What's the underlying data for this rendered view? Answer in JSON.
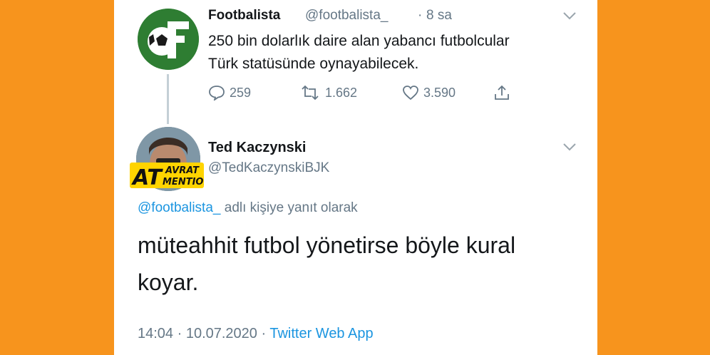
{
  "original_tweet": {
    "display_name": "Footbalista",
    "handle": "@footbalista_",
    "separator": "·",
    "time_ago": "8 sa",
    "text_line1": "250 bin dolarlık daire alan yabancı futbolcular",
    "text_line2": "Türk statüsünde oynayabilecek.",
    "avatar_icon": "footbalista-logo-icon",
    "actions": {
      "replies": "259",
      "retweets": "1.662",
      "likes": "3.590"
    }
  },
  "reply_tweet": {
    "display_name": "Ted Kaczynski",
    "handle": "@TedKaczynskiBJK",
    "badge_big": "AT",
    "badge_top": "AVRAT",
    "badge_bottom": "MENTION",
    "reply_to_mention": "@footbalista_",
    "reply_to_suffix": " adlı kişiye yanıt olarak",
    "text_line1": "müteahhit futbol yönetirse böyle kural",
    "text_line2": "koyar.",
    "timestamp": "14:04 · 10.07.2020 · ",
    "source_app": "Twitter Web App"
  },
  "colors": {
    "background_orange": "#f7941d",
    "panel": "#ffffff",
    "text": "#14171a",
    "muted": "#657786",
    "link": "#1b95e0",
    "logo_green": "#2e7d32"
  }
}
